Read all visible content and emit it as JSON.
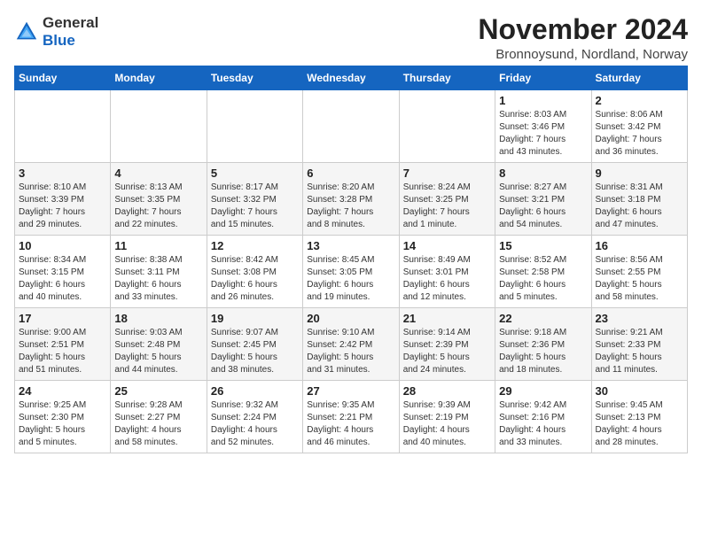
{
  "logo": {
    "general": "General",
    "blue": "Blue"
  },
  "title": "November 2024",
  "subtitle": "Bronnoysund, Nordland, Norway",
  "days_of_week": [
    "Sunday",
    "Monday",
    "Tuesday",
    "Wednesday",
    "Thursday",
    "Friday",
    "Saturday"
  ],
  "weeks": [
    [
      {
        "day": "",
        "info": ""
      },
      {
        "day": "",
        "info": ""
      },
      {
        "day": "",
        "info": ""
      },
      {
        "day": "",
        "info": ""
      },
      {
        "day": "",
        "info": ""
      },
      {
        "day": "1",
        "info": "Sunrise: 8:03 AM\nSunset: 3:46 PM\nDaylight: 7 hours\nand 43 minutes."
      },
      {
        "day": "2",
        "info": "Sunrise: 8:06 AM\nSunset: 3:42 PM\nDaylight: 7 hours\nand 36 minutes."
      }
    ],
    [
      {
        "day": "3",
        "info": "Sunrise: 8:10 AM\nSunset: 3:39 PM\nDaylight: 7 hours\nand 29 minutes."
      },
      {
        "day": "4",
        "info": "Sunrise: 8:13 AM\nSunset: 3:35 PM\nDaylight: 7 hours\nand 22 minutes."
      },
      {
        "day": "5",
        "info": "Sunrise: 8:17 AM\nSunset: 3:32 PM\nDaylight: 7 hours\nand 15 minutes."
      },
      {
        "day": "6",
        "info": "Sunrise: 8:20 AM\nSunset: 3:28 PM\nDaylight: 7 hours\nand 8 minutes."
      },
      {
        "day": "7",
        "info": "Sunrise: 8:24 AM\nSunset: 3:25 PM\nDaylight: 7 hours\nand 1 minute."
      },
      {
        "day": "8",
        "info": "Sunrise: 8:27 AM\nSunset: 3:21 PM\nDaylight: 6 hours\nand 54 minutes."
      },
      {
        "day": "9",
        "info": "Sunrise: 8:31 AM\nSunset: 3:18 PM\nDaylight: 6 hours\nand 47 minutes."
      }
    ],
    [
      {
        "day": "10",
        "info": "Sunrise: 8:34 AM\nSunset: 3:15 PM\nDaylight: 6 hours\nand 40 minutes."
      },
      {
        "day": "11",
        "info": "Sunrise: 8:38 AM\nSunset: 3:11 PM\nDaylight: 6 hours\nand 33 minutes."
      },
      {
        "day": "12",
        "info": "Sunrise: 8:42 AM\nSunset: 3:08 PM\nDaylight: 6 hours\nand 26 minutes."
      },
      {
        "day": "13",
        "info": "Sunrise: 8:45 AM\nSunset: 3:05 PM\nDaylight: 6 hours\nand 19 minutes."
      },
      {
        "day": "14",
        "info": "Sunrise: 8:49 AM\nSunset: 3:01 PM\nDaylight: 6 hours\nand 12 minutes."
      },
      {
        "day": "15",
        "info": "Sunrise: 8:52 AM\nSunset: 2:58 PM\nDaylight: 6 hours\nand 5 minutes."
      },
      {
        "day": "16",
        "info": "Sunrise: 8:56 AM\nSunset: 2:55 PM\nDaylight: 5 hours\nand 58 minutes."
      }
    ],
    [
      {
        "day": "17",
        "info": "Sunrise: 9:00 AM\nSunset: 2:51 PM\nDaylight: 5 hours\nand 51 minutes."
      },
      {
        "day": "18",
        "info": "Sunrise: 9:03 AM\nSunset: 2:48 PM\nDaylight: 5 hours\nand 44 minutes."
      },
      {
        "day": "19",
        "info": "Sunrise: 9:07 AM\nSunset: 2:45 PM\nDaylight: 5 hours\nand 38 minutes."
      },
      {
        "day": "20",
        "info": "Sunrise: 9:10 AM\nSunset: 2:42 PM\nDaylight: 5 hours\nand 31 minutes."
      },
      {
        "day": "21",
        "info": "Sunrise: 9:14 AM\nSunset: 2:39 PM\nDaylight: 5 hours\nand 24 minutes."
      },
      {
        "day": "22",
        "info": "Sunrise: 9:18 AM\nSunset: 2:36 PM\nDaylight: 5 hours\nand 18 minutes."
      },
      {
        "day": "23",
        "info": "Sunrise: 9:21 AM\nSunset: 2:33 PM\nDaylight: 5 hours\nand 11 minutes."
      }
    ],
    [
      {
        "day": "24",
        "info": "Sunrise: 9:25 AM\nSunset: 2:30 PM\nDaylight: 5 hours\nand 5 minutes."
      },
      {
        "day": "25",
        "info": "Sunrise: 9:28 AM\nSunset: 2:27 PM\nDaylight: 4 hours\nand 58 minutes."
      },
      {
        "day": "26",
        "info": "Sunrise: 9:32 AM\nSunset: 2:24 PM\nDaylight: 4 hours\nand 52 minutes."
      },
      {
        "day": "27",
        "info": "Sunrise: 9:35 AM\nSunset: 2:21 PM\nDaylight: 4 hours\nand 46 minutes."
      },
      {
        "day": "28",
        "info": "Sunrise: 9:39 AM\nSunset: 2:19 PM\nDaylight: 4 hours\nand 40 minutes."
      },
      {
        "day": "29",
        "info": "Sunrise: 9:42 AM\nSunset: 2:16 PM\nDaylight: 4 hours\nand 33 minutes."
      },
      {
        "day": "30",
        "info": "Sunrise: 9:45 AM\nSunset: 2:13 PM\nDaylight: 4 hours\nand 28 minutes."
      }
    ]
  ]
}
